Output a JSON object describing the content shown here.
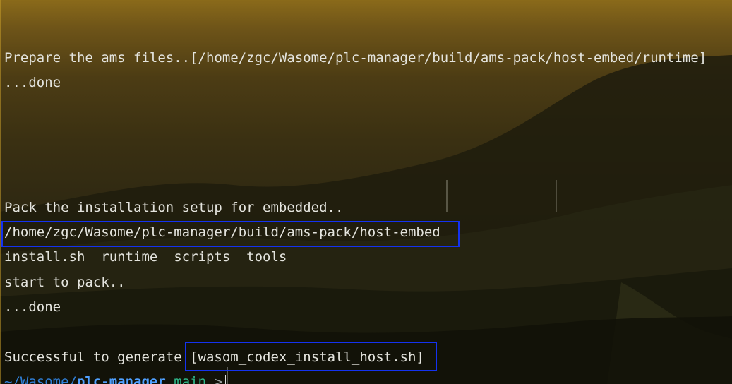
{
  "terminal": {
    "lines": [
      "Prepare the ams files..[/home/zgc/Wasome/plc-manager/build/ams-pack/host-embed/runtime]",
      "...done",
      "Pack the installation setup for embedded..",
      "/home/zgc/Wasome/plc-manager/build/ams-pack/host-embed",
      "install.sh  runtime  scripts  tools",
      "start to pack..",
      "...done"
    ],
    "success_prefix": "Successful to generate ",
    "success_file": "[wasom_codex_install_host.sh]",
    "prompt": {
      "tilde": "~",
      "path": "/Wasome/",
      "current_dir": "plc-manager",
      "branch": "main",
      "arrow": ">"
    }
  },
  "colors": {
    "highlight_box": "#1432f0",
    "prompt_path": "#2f7fd8",
    "prompt_branch": "#2fb88a",
    "text": "#e4e4de"
  }
}
